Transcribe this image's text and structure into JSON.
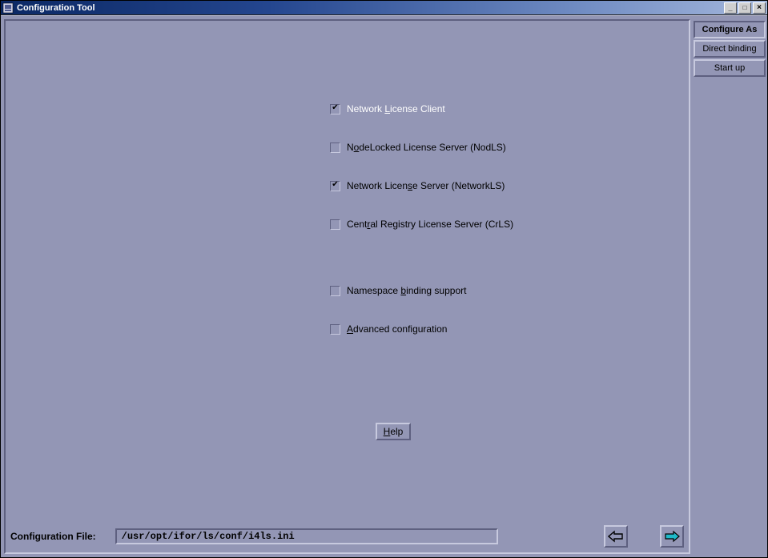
{
  "window": {
    "title": "Configuration Tool"
  },
  "tabs": {
    "configure_as": "Configure As",
    "direct_binding": "Direct binding",
    "start_up": "Start up"
  },
  "checks": {
    "net_client": {
      "label_pre": "Network ",
      "label_u": "L",
      "label_post": "icense Client",
      "checked": true,
      "disabled": true
    },
    "nodls": {
      "label_pre": "N",
      "label_u": "o",
      "label_post": "deLocked License Server (NodLS)",
      "checked": false,
      "disabled": false
    },
    "networkls": {
      "label_pre": "Network Licen",
      "label_u": "s",
      "label_post": "e Server (NetworkLS)",
      "checked": true,
      "disabled": false
    },
    "crls": {
      "label_pre": "Cent",
      "label_u": "r",
      "label_post": "al Registry License Server (CrLS)",
      "checked": false,
      "disabled": false
    },
    "nsbind": {
      "label_pre": "Namespace ",
      "label_u": "b",
      "label_post": "inding support",
      "checked": false,
      "disabled": false
    },
    "advcfg": {
      "label_pre": "",
      "label_u": "A",
      "label_post": "dvanced configuration",
      "checked": false,
      "disabled": false
    }
  },
  "help": {
    "label_u": "H",
    "label_post": "elp"
  },
  "config_file": {
    "label": "Configuration File:",
    "value": "/usr/opt/ifor/ls/conf/i4ls.ini"
  }
}
